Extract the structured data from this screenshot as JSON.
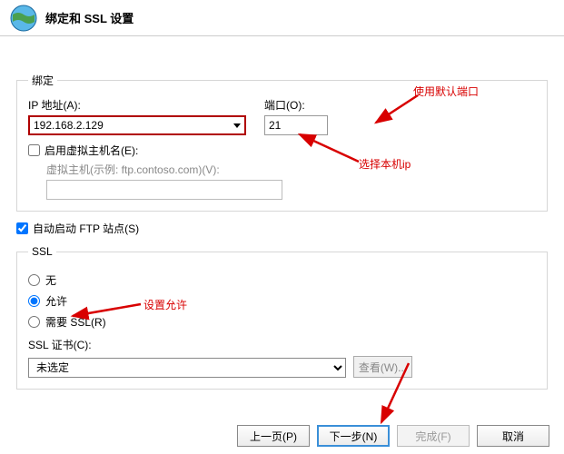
{
  "header": {
    "title": "绑定和 SSL 设置"
  },
  "binding": {
    "legend": "绑定",
    "ip_label": "IP 地址(A):",
    "ip_value": "192.168.2.129",
    "port_label": "端口(O):",
    "port_value": "21",
    "enable_vhost_label": "启用虚拟主机名(E):",
    "enable_vhost_checked": false,
    "vhost_label": "虚拟主机(示例: ftp.contoso.com)(V):",
    "vhost_value": ""
  },
  "autostart": {
    "label": "自动启动 FTP 站点(S)",
    "checked": true
  },
  "ssl": {
    "legend": "SSL",
    "opt_none": "无",
    "opt_allow": "允许",
    "opt_require": "需要 SSL(R)",
    "selected": "allow",
    "cert_label": "SSL 证书(C):",
    "cert_value": "未选定",
    "view_btn": "查看(W)..."
  },
  "buttons": {
    "prev": "上一页(P)",
    "next": "下一步(N)",
    "finish": "完成(F)",
    "cancel": "取消"
  },
  "annotations": {
    "default_port": "使用默认端口",
    "select_ip": "选择本机ip",
    "set_allow": "设置允许"
  }
}
